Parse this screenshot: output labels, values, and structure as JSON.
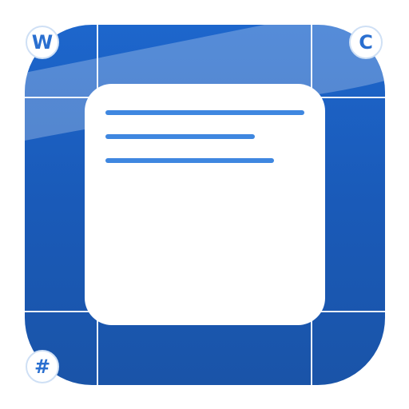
{
  "icon": {
    "colors": {
      "tile": "#1d66cc",
      "tile_dark": "#1a54a8",
      "card": "#ffffff",
      "note_lines": "#3f87e0",
      "badge_text": "#2a6fd0"
    },
    "note_card": {
      "line_count": 3
    },
    "badges": {
      "top_left": "W",
      "top_right": "C",
      "bottom_left": "#"
    }
  }
}
